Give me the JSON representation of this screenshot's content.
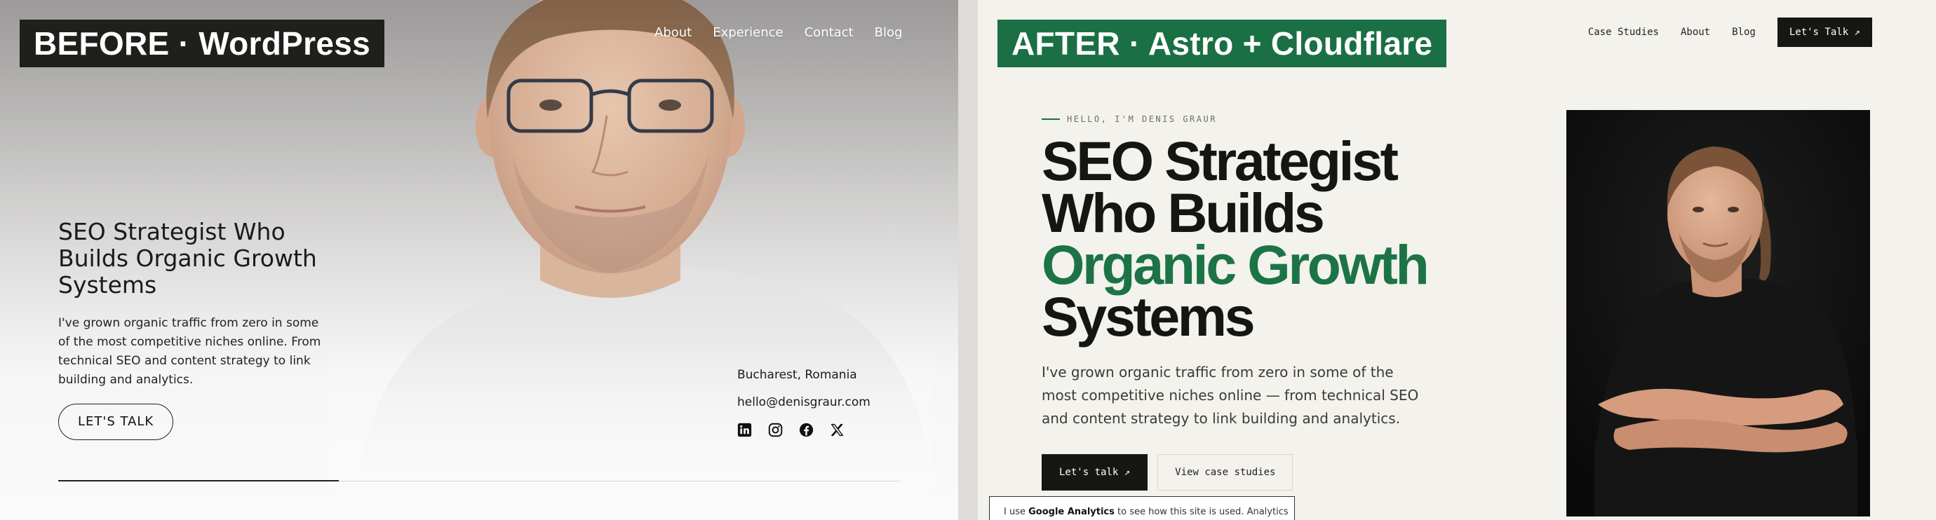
{
  "before": {
    "tag": "BEFORE · WordPress",
    "nav": [
      "About",
      "Experience",
      "Contact",
      "Blog"
    ],
    "hero_title": "SEO Strategist Who Builds Organic Growth Systems",
    "hero_text": "I've grown organic traffic from zero in some of the most competitive niches online. From technical SEO and content strategy to link building and analytics.",
    "cta": "LET'S TALK",
    "location": "Bucharest, Romania",
    "email": "hello@denisgraur.com",
    "socials": [
      "linkedin-icon",
      "instagram-icon",
      "facebook-icon",
      "x-icon"
    ]
  },
  "after": {
    "tag": "AFTER · Astro + Cloudflare",
    "nav": [
      "Case Studies",
      "About",
      "Blog"
    ],
    "nav_cta": "Let's Talk ↗",
    "eyebrow": "HELLO, I'M DENIS GRAUR",
    "hero_line1": "SEO Strategist",
    "hero_line2": "Who Builds",
    "hero_line3": "Organic Growth",
    "hero_line4": "Systems",
    "hero_text": "I've grown organic traffic from zero in some of the most competitive niches online — from technical SEO and content strategy to link building and analytics.",
    "btn_primary": "Let's talk ↗",
    "btn_secondary": "View case studies",
    "cookie_pre": "I use ",
    "cookie_bold": "Google Analytics",
    "cookie_post": " to see how this site is used. Analytics"
  },
  "colors": {
    "accent_green": "#1c7446",
    "tag_green": "#1b6f45",
    "dark": "#161614",
    "after_bg": "#f3f2ed"
  }
}
